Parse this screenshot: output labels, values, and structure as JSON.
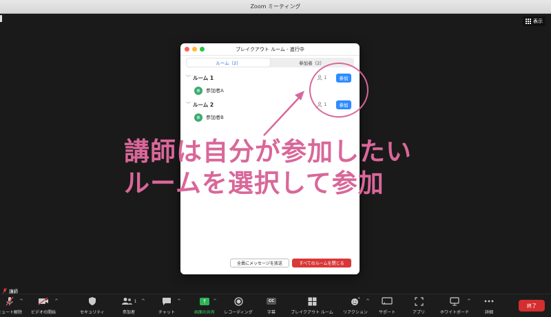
{
  "window": {
    "title": "Zoom ミーティング"
  },
  "view_button": {
    "label": "表示"
  },
  "dialog": {
    "title": "ブレイクアウト ルーム - 進行中",
    "tabs": [
      {
        "label": "ルーム（2）",
        "active": true
      },
      {
        "label": "参加者（2）",
        "active": false
      }
    ],
    "rooms": [
      {
        "name": "ルーム 1",
        "count": "1",
        "join_label": "参加",
        "members": [
          {
            "avatar": "参",
            "name": "参加者A"
          }
        ]
      },
      {
        "name": "ルーム 2",
        "count": "1",
        "join_label": "参加",
        "members": [
          {
            "avatar": "参",
            "name": "参加者B"
          }
        ]
      }
    ],
    "broadcast_label": "全員にメッセージを放送",
    "close_all_label": "すべてのルームを閉じる"
  },
  "annotation": {
    "line1": "講師は自分が参加したい",
    "line2": "ルームを選択して参加",
    "color": "#d9679a"
  },
  "speaker": {
    "name": "講師"
  },
  "toolbar": {
    "items": [
      {
        "label": "ミュート解除",
        "icon": "mic-muted-icon"
      },
      {
        "label": "ビデオの開始",
        "icon": "video-off-icon"
      },
      {
        "label": "セキュリティ",
        "icon": "shield-icon"
      },
      {
        "label": "参加者",
        "icon": "participants-icon",
        "count": "1"
      },
      {
        "label": "チャット",
        "icon": "chat-icon"
      },
      {
        "label": "画面の共有",
        "icon": "share-screen-icon"
      },
      {
        "label": "レコーディング",
        "icon": "record-icon"
      },
      {
        "label": "字幕",
        "icon": "cc-icon",
        "cc_text": "CC"
      },
      {
        "label": "ブレイクアウト ルーム",
        "icon": "breakout-icon"
      },
      {
        "label": "リアクション",
        "icon": "reaction-icon"
      },
      {
        "label": "サポート",
        "icon": "support-icon"
      },
      {
        "label": "アプリ",
        "icon": "apps-icon"
      },
      {
        "label": "ホワイトボード",
        "icon": "whiteboard-icon"
      },
      {
        "label": "詳細",
        "icon": "more-icon"
      }
    ],
    "end_label": "終了",
    "share_color": "#2fb256",
    "end_color": "#d42e2e"
  }
}
